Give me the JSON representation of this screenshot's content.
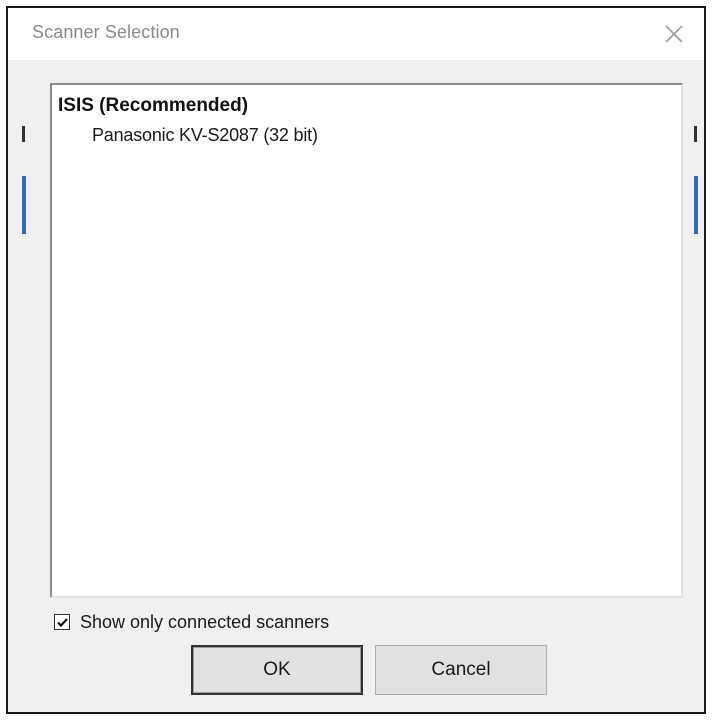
{
  "dialog": {
    "title": "Scanner Selection",
    "close_icon": "close-icon"
  },
  "scanner_list": {
    "group_header": "ISIS (Recommended)",
    "items": [
      {
        "label": "Panasonic KV-S2087 (32 bit)"
      }
    ]
  },
  "filter": {
    "label": "Show only connected scanners",
    "checked": true
  },
  "buttons": {
    "ok_label": "OK",
    "cancel_label": "Cancel"
  },
  "colors": {
    "dialog_background": "#f0f0f0",
    "title_text": "#8a8a8a",
    "list_background": "#ffffff",
    "button_face": "#e1e1e1",
    "background_accent": "#2e6bb5"
  }
}
